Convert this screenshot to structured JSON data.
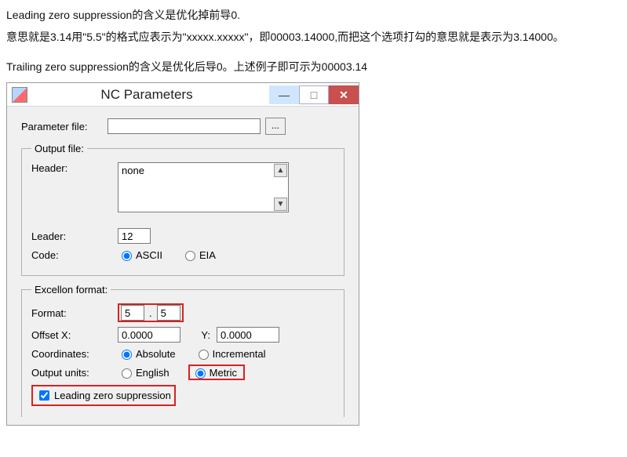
{
  "description": {
    "line1": "Leading zero suppression的含义是优化掉前导0.",
    "line2": "意思就是3.14用\"5.5\"的格式应表示为\"xxxxx.xxxxx\"，即00003.14000,而把这个选项打勾的意思就是表示为3.14000。",
    "line3": "Trailing zero suppression的含义是优化后导0。上述例子即可示为00003.14"
  },
  "window": {
    "title": "NC Parameters",
    "min_glyph": "—",
    "max_glyph": "□",
    "close_glyph": "✕"
  },
  "param_file": {
    "label": "Parameter file:",
    "value": "",
    "browse": "..."
  },
  "output_file": {
    "legend": "Output file:",
    "header_label": "Header:",
    "header_value": "none",
    "leader_label": "Leader:",
    "leader_value": "12",
    "code_label": "Code:",
    "code_ascii": "ASCII",
    "code_eia": "EIA"
  },
  "excellon": {
    "legend": "Excellon format:",
    "format_label": "Format:",
    "format_int": "5",
    "format_dec": "5",
    "format_dot": ".",
    "offx_label": "Offset X:",
    "offx_value": "0.0000",
    "y_label": "Y:",
    "offy_value": "0.0000",
    "coords_label": "Coordinates:",
    "coords_abs": "Absolute",
    "coords_inc": "Incremental",
    "units_label": "Output units:",
    "units_en": "English",
    "units_metric": "Metric",
    "lzs_label": "Leading zero suppression"
  }
}
